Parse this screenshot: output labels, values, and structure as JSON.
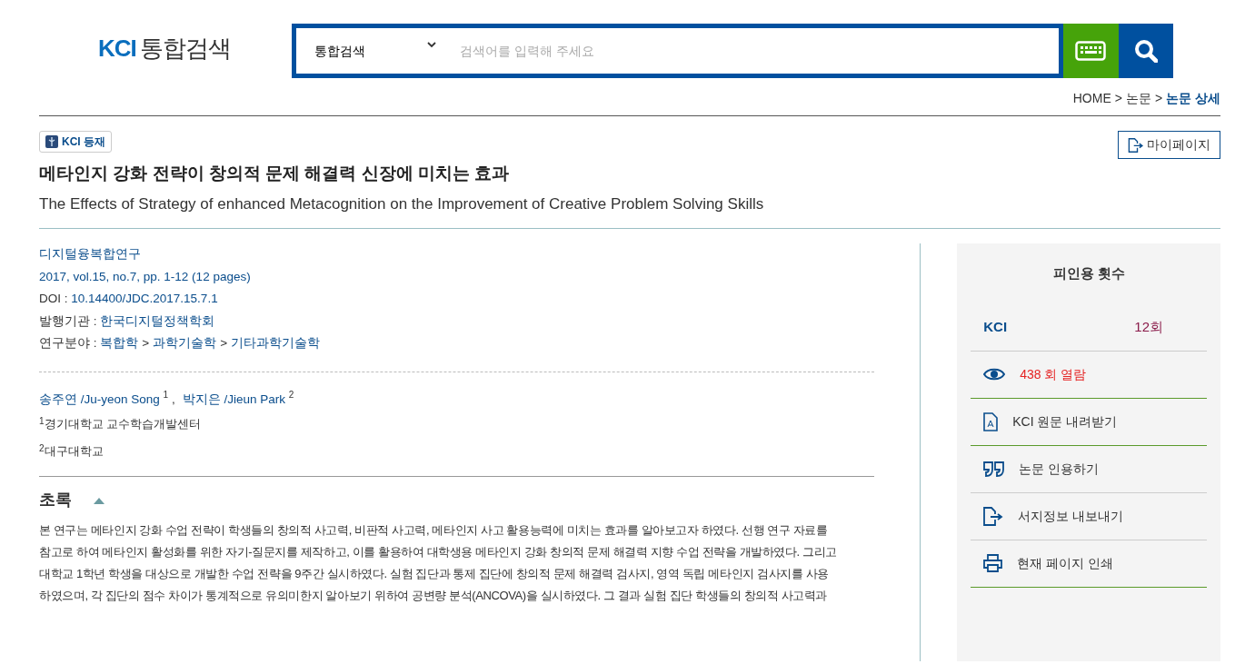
{
  "logo": {
    "brand": "KCI",
    "text": "통합검색"
  },
  "search": {
    "scope": "통합검색",
    "placeholder": "검색어를 입력해 주세요"
  },
  "breadcrumb_separator": ">",
  "breadcrumb": [
    {
      "label": "HOME",
      "current": false
    },
    {
      "label": "논문",
      "current": false
    },
    {
      "label": "논문 상세",
      "current": true
    }
  ],
  "badge": "KCI 등재",
  "mypage": "마이페이지",
  "title_ko": "메타인지 강화 전략이 창의적 문제 해결력 신장에 미치는 효과",
  "title_en": "The Effects of Strategy of enhanced Metacognition on the Improvement of Creative Problem Solving Skills",
  "meta": {
    "journal": "디지털융복합연구",
    "issue": "2017, vol.15, no.7, pp. 1-12 (12 pages)",
    "doi_label": "DOI : ",
    "doi": "10.14400/JDC.2017.15.7.1",
    "publisher_label": "발행기관 : ",
    "publisher": "한국디지털정책학회",
    "field_label": "연구분야 : ",
    "fields": [
      "복합학",
      "과학기술학",
      "기타과학기술학"
    ],
    "field_separator": ">"
  },
  "author_separator": ",",
  "authors": [
    {
      "name": "송주연 /Ju-yeon Song",
      "mark": "1"
    },
    {
      "name": "박지은 /Jieun Park",
      "mark": "2"
    }
  ],
  "affiliations": [
    {
      "mark": "1",
      "name": "경기대학교 교수학습개발센터"
    },
    {
      "mark": "2",
      "name": "대구대학교"
    }
  ],
  "abstract": {
    "heading": "초록",
    "expanded": true,
    "lines": [
      "본 연구는 메타인지 강화 수업 전략이 학생들의 창의적 사고력, 비판적 사고력, 메타인지 사고 활용능력에 미치는 효과를 알아보고자 하였다. 선행 연구 자료를",
      "참고로 하여 메타인지 활성화를 위한 자기-질문지를 제작하고, 이를 활용하여 대학생용 메타인지 강화 창의적 문제 해결력 지향 수업 전략을 개발하였다. 그리고",
      "대학교 1학년 학생을 대상으로 개발한 수업 전략을 9주간 실시하였다. 실험 집단과 통제 집단에 창의적 문제 해결력 검사지, 영역 독립 메타인지 검사지를 사용",
      "하였으며, 각 집단의 점수 차이가 통계적으로 유의미한지 알아보기 위하여 공변량 분석(ANCOVA)을 실시하였다. 그 결과 실험 집단 학생들의 창의적 사고력과"
    ]
  },
  "side": {
    "heading": "피인용 횟수",
    "citation_source": "KCI",
    "citation_count": "12회",
    "actions": [
      {
        "kind": "views",
        "label": "438 회 열람"
      },
      {
        "kind": "pdf",
        "label": "KCI 원문 내려받기"
      },
      {
        "kind": "cite",
        "label": "논문 인용하기"
      },
      {
        "kind": "export",
        "label": "서지정보 내보내기"
      },
      {
        "kind": "print",
        "label": "현재 페이지 인쇄"
      }
    ]
  }
}
